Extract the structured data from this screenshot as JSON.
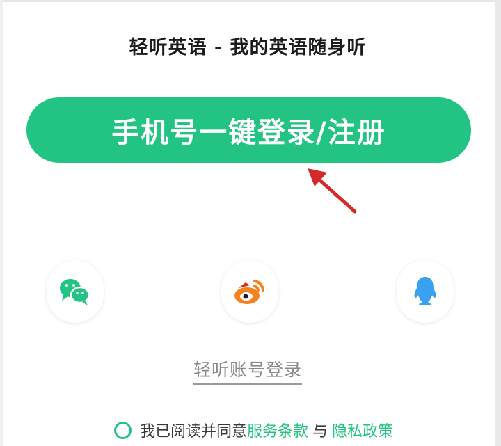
{
  "header": {
    "title": "轻听英语 - 我的英语随身听"
  },
  "login": {
    "phone_button_label": "手机号一键登录/注册"
  },
  "third_party": {
    "items": [
      {
        "id": "wechat",
        "icon": "wechat-icon",
        "color": "#23c483"
      },
      {
        "id": "weibo",
        "icon": "weibo-icon",
        "color": "#f58220"
      },
      {
        "id": "qq",
        "icon": "qq-icon",
        "color": "#3aa0f0"
      }
    ]
  },
  "account_login": {
    "label": "轻听账号登录"
  },
  "agreement": {
    "prefix": "我已阅读并同意",
    "terms_label": "服务条款",
    "and": "与",
    "privacy_label": "隐私政策"
  },
  "colors": {
    "accent": "#23c483",
    "annotation_arrow": "#d62a2a"
  }
}
